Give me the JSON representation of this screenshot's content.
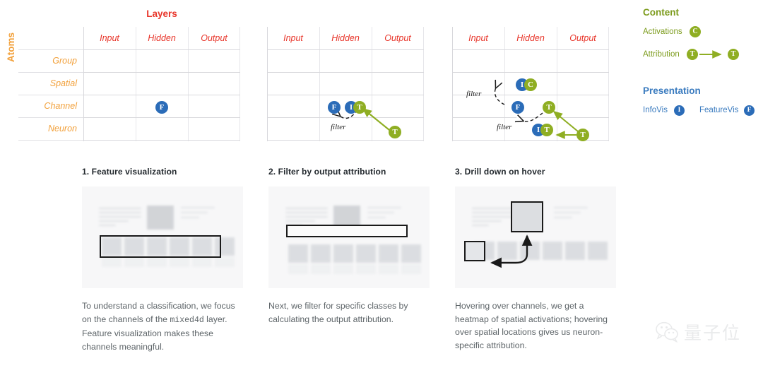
{
  "diagram": {
    "axis_titles": {
      "columns": "Layers",
      "rows": "Atoms"
    },
    "column_headers": [
      "Input",
      "Hidden",
      "Output"
    ],
    "row_headers": [
      "Group",
      "Spatial",
      "Channel",
      "Neuron"
    ],
    "filter_label": "filter",
    "badges": {
      "featurevis": "F",
      "infovis": "I",
      "attribution": "T",
      "activations": "C"
    },
    "colors": {
      "columns_title": "#e8352a",
      "rows_title": "#f2a13c",
      "blue": "#2b6cb8",
      "green": "#8fae23",
      "content_heading": "#7d9c1e",
      "presentation_heading": "#3a7bbf",
      "grid_line": "#d8d8dc"
    }
  },
  "legend": {
    "content": {
      "heading": "Content",
      "items": [
        {
          "label": "Activations",
          "glyph": "C"
        },
        {
          "label": "Attribution",
          "glyph": "T"
        }
      ]
    },
    "presentation": {
      "heading": "Presentation",
      "items": [
        {
          "label": "InfoVis",
          "glyph": "I"
        },
        {
          "label": "FeatureVis",
          "glyph": "F"
        }
      ]
    }
  },
  "panels": [
    {
      "title": "1. Feature visualization",
      "caption_part1": "To understand a classification, we focus on the channels of the ",
      "caption_code": "mixed4d",
      "caption_part2": " layer. Feature visualization makes these channels meaningful."
    },
    {
      "title": "2. Filter by output attribution",
      "caption_part1": "Next, we filter for specific classes by calculating the output attribution.",
      "caption_code": "",
      "caption_part2": ""
    },
    {
      "title": "3. Drill down on hover",
      "caption_part1": "Hovering over channels, we get a heatmap of spatial activations; hovering over spatial locations gives us neuron-specific attribution.",
      "caption_code": "",
      "caption_part2": ""
    }
  ],
  "watermark": {
    "text": "量子位"
  }
}
